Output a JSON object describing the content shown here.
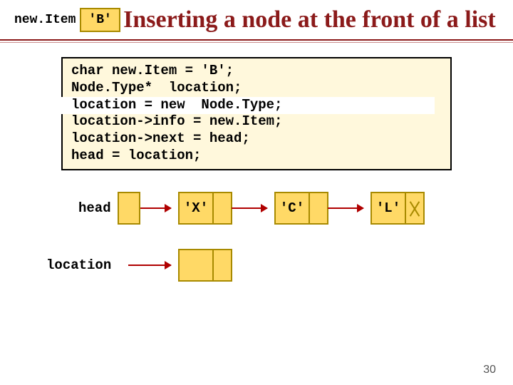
{
  "title": "Inserting a node at the front of a list",
  "newItemLabel": "new.Item",
  "newItemValue": "'B'",
  "code": [
    "char new.Item = 'B';",
    "Node.Type*  location;",
    "location = new  Node.Type;",
    "location->info = new.Item;",
    "location->next = head;",
    "head = location;"
  ],
  "headLabel": "head",
  "locationLabel": "location",
  "nodes": [
    "'X'",
    "'C'",
    "'L'"
  ],
  "pageNumber": "30"
}
